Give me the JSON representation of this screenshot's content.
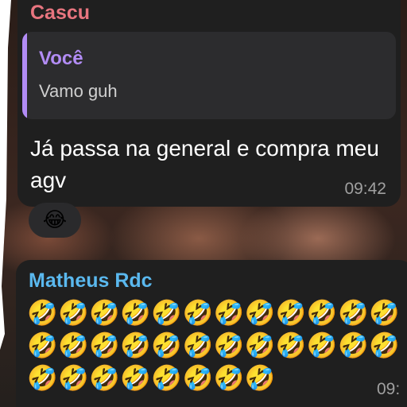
{
  "messages": [
    {
      "sender": "Cascu",
      "sender_color": "#e8757f",
      "reply": {
        "author": "Você",
        "author_color": "#b28cf5",
        "text": "Vamo guh"
      },
      "text": "Já passa na general e compra meu agv",
      "time": "09:42",
      "reaction": "😂"
    },
    {
      "sender": "Matheus Rdc",
      "sender_color": "#5ab8ee",
      "text": "🤣🤣🤣🤣🤣🤣🤣🤣🤣🤣🤣🤣🤣🤣🤣🤣🤣🤣🤣🤣🤣🤣🤣🤣🤣🤣🤣🤣🤣🤣🤣🤣",
      "time": "09:"
    }
  ]
}
